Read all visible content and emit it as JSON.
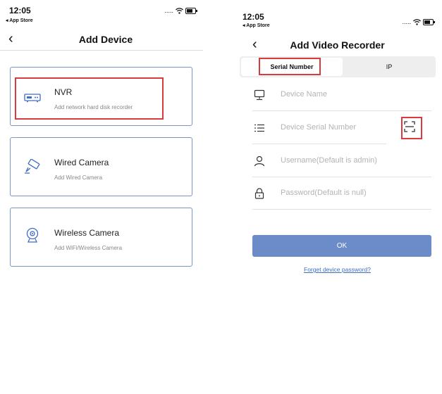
{
  "left": {
    "status": {
      "time": "12:05",
      "back_app": "◂ App Store",
      "signal": "....."
    },
    "nav": {
      "back": "‹",
      "title": "Add Device"
    },
    "cards": [
      {
        "title": "NVR",
        "subtitle": "Add network hard disk recorder",
        "icon": "nvr-recorder-icon"
      },
      {
        "title": "Wired Camera",
        "subtitle": "Add Wired Camera",
        "icon": "wired-camera-icon"
      },
      {
        "title": "Wireless Camera",
        "subtitle": "Add WiFi/Wireless Camera",
        "icon": "wireless-camera-icon"
      }
    ]
  },
  "right": {
    "status": {
      "time": "12:05",
      "back_app": "◂ App Store",
      "signal": "....."
    },
    "nav": {
      "back": "‹",
      "title": "Add Video Recorder"
    },
    "tabs": {
      "serial": "Serial Number",
      "ip": "IP"
    },
    "fields": [
      {
        "placeholder": "Device Name",
        "icon": "monitor-icon"
      },
      {
        "placeholder": "Device Serial Number",
        "icon": "list-icon"
      },
      {
        "placeholder": "Username(Default is admin)",
        "icon": "user-icon"
      },
      {
        "placeholder": "Password(Default is null)",
        "icon": "lock-icon"
      }
    ],
    "scan_icon": "scan-qr-icon",
    "ok_label": "OK",
    "forget_label": "Forget device password?"
  },
  "colors": {
    "accent": "#6b8bc9",
    "highlight": "#d93b3b",
    "card_border": "#7a96c8",
    "link": "#3f6cc4"
  }
}
